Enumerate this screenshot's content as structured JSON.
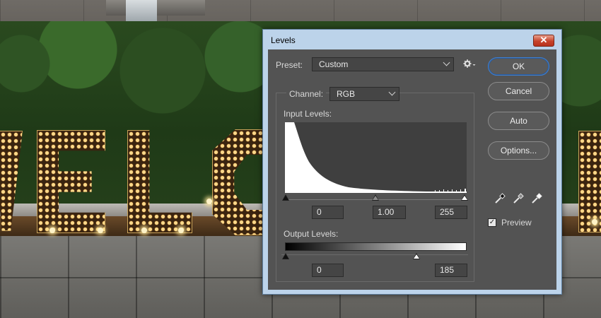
{
  "dialog": {
    "title": "Levels",
    "close_glyph": "✕",
    "preset": {
      "label": "Preset:",
      "value": "Custom"
    },
    "channel": {
      "label": "Channel:",
      "value": "RGB"
    },
    "input_levels": {
      "label": "Input Levels:",
      "black": "0",
      "gamma": "1.00",
      "white": "255"
    },
    "output_levels": {
      "label": "Output Levels:",
      "black": "0",
      "white": "185"
    },
    "buttons": {
      "ok": "OK",
      "cancel": "Cancel",
      "auto": "Auto",
      "options": "Options..."
    },
    "preview": {
      "label": "Preview",
      "checked": true,
      "check_glyph": "✓"
    },
    "icons": {
      "gear": "gear-icon",
      "pickers": [
        "black-eyedropper-icon",
        "gray-eyedropper-icon",
        "white-eyedropper-icon"
      ]
    },
    "colors": {
      "panel": "#535353",
      "titlebar": "#bcd3ea",
      "ok_ring": "#3f7fcf",
      "histogram_fill": "#ffffff"
    }
  },
  "background": {
    "description_text": "",
    "sign_letters": [
      "V",
      "E",
      "L",
      "C",
      "M"
    ]
  }
}
